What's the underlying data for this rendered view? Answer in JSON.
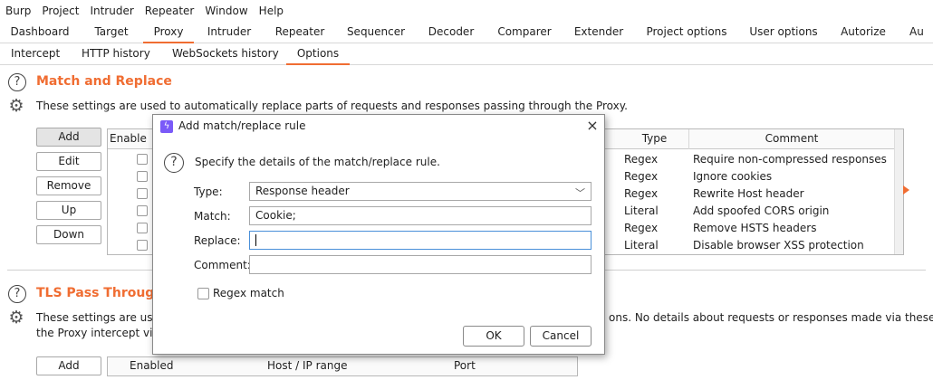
{
  "menubar": [
    "Burp",
    "Project",
    "Intruder",
    "Repeater",
    "Window",
    "Help"
  ],
  "main_tabs": [
    "Dashboard",
    "Target",
    "Proxy",
    "Intruder",
    "Repeater",
    "Sequencer",
    "Decoder",
    "Comparer",
    "Extender",
    "Project options",
    "User options",
    "Autorize",
    "Au"
  ],
  "main_tab_active": "Proxy",
  "proxy_tabs": [
    "Intercept",
    "HTTP history",
    "WebSockets history",
    "Options"
  ],
  "proxy_tab_active": "Options",
  "match_replace": {
    "title": "Match and Replace",
    "description": "These settings are used to automatically replace parts of requests and responses passing through the Proxy.",
    "buttons": [
      "Add",
      "Edit",
      "Remove",
      "Up",
      "Down"
    ],
    "columns": [
      "Enable",
      "Type",
      "Comment"
    ],
    "rows": [
      {
        "type": "Regex",
        "comment": "Require non-compressed responses"
      },
      {
        "type": "Regex",
        "comment": "Ignore cookies"
      },
      {
        "type": "Regex",
        "comment": "Rewrite Host header"
      },
      {
        "type": "Literal",
        "comment": "Add spoofed CORS origin"
      },
      {
        "type": "Regex",
        "comment": "Remove HSTS headers"
      },
      {
        "type": "Literal",
        "comment": "Disable browser XSS protection"
      }
    ]
  },
  "tls": {
    "title": "TLS Pass Through",
    "description_left": "These settings are used",
    "description_right": "ons. No details about requests or responses made via these conn",
    "description_line2": "the Proxy intercept view",
    "buttons": [
      "Add"
    ],
    "columns": [
      "Enabled",
      "Host / IP range",
      "Port"
    ]
  },
  "dialog": {
    "title": "Add match/replace rule",
    "close_icon": "×",
    "prompt": "Specify the details of the match/replace rule.",
    "type_label": "Type:",
    "type_value": "Response header",
    "match_label": "Match:",
    "match_value": "Cookie;",
    "replace_label": "Replace:",
    "replace_value": "",
    "comment_label": "Comment:",
    "comment_value": "",
    "regex_label": "Regex match",
    "regex_checked": false,
    "ok_label": "OK",
    "cancel_label": "Cancel"
  },
  "colors": {
    "accent": "#f06d32",
    "focus": "#4a90d9"
  }
}
